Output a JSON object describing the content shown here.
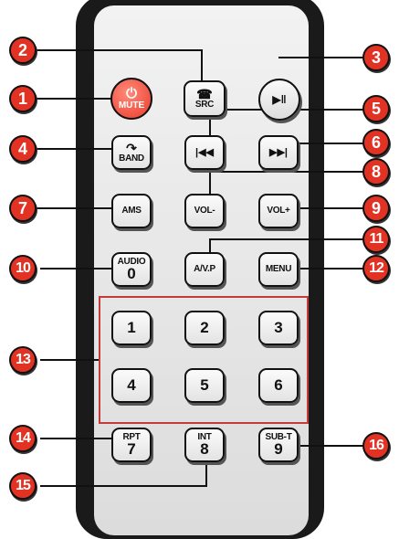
{
  "buttons": {
    "mute": {
      "icon": "power-icon",
      "label": "MUTE"
    },
    "src": {
      "icon": "phone-icon",
      "label": "SRC"
    },
    "play_pause": {
      "icon": "play-pause-icon",
      "glyph": "▶‖"
    },
    "band": {
      "icon": "phone-handset-icon",
      "label": "BAND"
    },
    "prev": {
      "icon": "previous-track-icon",
      "glyph": "|◀◀"
    },
    "next": {
      "icon": "next-track-icon",
      "glyph": "▶▶|"
    },
    "ams": {
      "label": "AMS"
    },
    "vol_down": {
      "label": "VOL-"
    },
    "vol_up": {
      "label": "VOL+"
    },
    "audio": {
      "label": "AUDIO",
      "digit": "0"
    },
    "avp": {
      "label": "A/V.P"
    },
    "menu": {
      "label": "MENU"
    },
    "n1": "1",
    "n2": "2",
    "n3": "3",
    "n4": "4",
    "n5": "5",
    "n6": "6",
    "rpt": {
      "label": "RPT",
      "digit": "7"
    },
    "int": {
      "label": "INT",
      "digit": "8"
    },
    "subt": {
      "label": "SUB-T",
      "digit": "9"
    }
  },
  "callouts": [
    "1",
    "2",
    "3",
    "4",
    "5",
    "6",
    "7",
    "8",
    "9",
    "10",
    "11",
    "12",
    "13",
    "14",
    "15",
    "16"
  ],
  "colors": {
    "callout": "#e23224",
    "power_button": "#ea3b2a",
    "remote_body": "#1a1a1a",
    "box": "#c23c3c"
  }
}
